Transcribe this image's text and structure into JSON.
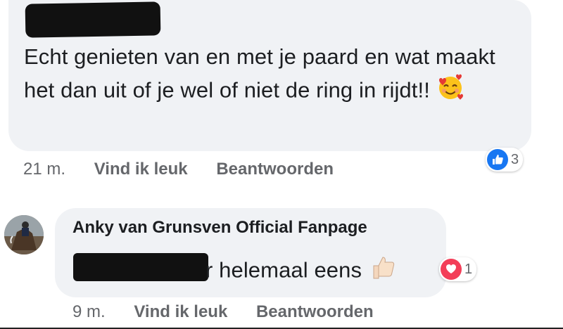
{
  "comments": [
    {
      "author": "",
      "text": "Echt genieten van en met je paard en wat maakt het dan uit of je wel of niet de ring in rijdt!!",
      "emoji": "smiling-face-with-hearts",
      "time": "21 m.",
      "like_label": "Vind ik leuk",
      "reply_label": "Beantwoorden",
      "reaction": {
        "type": "like",
        "count": "3",
        "color": "#1877f2"
      }
    },
    {
      "author": "Anky van Grunsven Official Fanpage",
      "text": "r helemaal eens",
      "emoji": "thumbs-up-light-skin",
      "time": "9 m.",
      "like_label": "Vind ik leuk",
      "reply_label": "Beantwoorden",
      "reaction": {
        "type": "love",
        "count": "1",
        "color": "#f33e58"
      }
    }
  ],
  "colors": {
    "bubble": "#f0f2f5",
    "meta_text": "#65676b",
    "redaction": "#111111"
  }
}
